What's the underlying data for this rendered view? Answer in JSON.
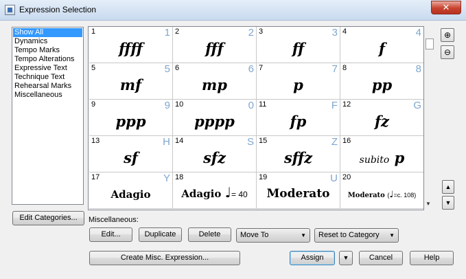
{
  "window": {
    "title": "Expression Selection",
    "close_glyph": "✕"
  },
  "categories": {
    "items": [
      "Show All",
      "Dynamics",
      "Tempo Marks",
      "Tempo Alterations",
      "Expressive Text",
      "Technique Text",
      "Rehearsal Marks",
      "Miscellaneous"
    ],
    "selected_index": 0
  },
  "cells": [
    {
      "num": "1",
      "key": "1",
      "text": "ffff"
    },
    {
      "num": "2",
      "key": "2",
      "text": "fff"
    },
    {
      "num": "3",
      "key": "3",
      "text": "ff"
    },
    {
      "num": "4",
      "key": "4",
      "text": "f"
    },
    {
      "num": "5",
      "key": "5",
      "text": "mf"
    },
    {
      "num": "6",
      "key": "6",
      "text": "mp"
    },
    {
      "num": "7",
      "key": "7",
      "text": "p"
    },
    {
      "num": "8",
      "key": "8",
      "text": "pp"
    },
    {
      "num": "9",
      "key": "9",
      "text": "ppp"
    },
    {
      "num": "10",
      "key": "0",
      "text": "pppp"
    },
    {
      "num": "11",
      "key": "F",
      "text": "fp"
    },
    {
      "num": "12",
      "key": "G",
      "text": "fz"
    },
    {
      "num": "13",
      "key": "H",
      "text": "sf"
    },
    {
      "num": "14",
      "key": "S",
      "text": "sfz"
    },
    {
      "num": "15",
      "key": "Z",
      "text": "sffz"
    },
    {
      "num": "16",
      "key": "",
      "subito": "subito",
      "text": "p"
    },
    {
      "num": "17",
      "key": "Y",
      "text": "Adagio"
    },
    {
      "num": "18",
      "key": "",
      "text": "Adagio",
      "note": "♩",
      "mm": "= 40"
    },
    {
      "num": "19",
      "key": "U",
      "text": "Moderato"
    },
    {
      "num": "20",
      "key": "",
      "text": "Moderato",
      "mm_open": "(",
      "note": "♩",
      "mm": "=c. 108)"
    }
  ],
  "buttons": {
    "edit_categories": "Edit Categories...",
    "edit": "Edit...",
    "duplicate": "Duplicate",
    "delete": "Delete",
    "create_misc": "Create Misc. Expression...",
    "assign": "Assign",
    "assign_arrow": "▼",
    "cancel": "Cancel",
    "help": "Help"
  },
  "misc_label": "Miscellaneous:",
  "dropdowns": {
    "move_to": "Move To",
    "reset_to_category": "Reset to Category",
    "arrow": "▼"
  },
  "tools": {
    "zoom_in": "⊕",
    "zoom_out": "⊖",
    "move_up": "▲",
    "move_down": "▼",
    "scroll_down": "▼"
  }
}
